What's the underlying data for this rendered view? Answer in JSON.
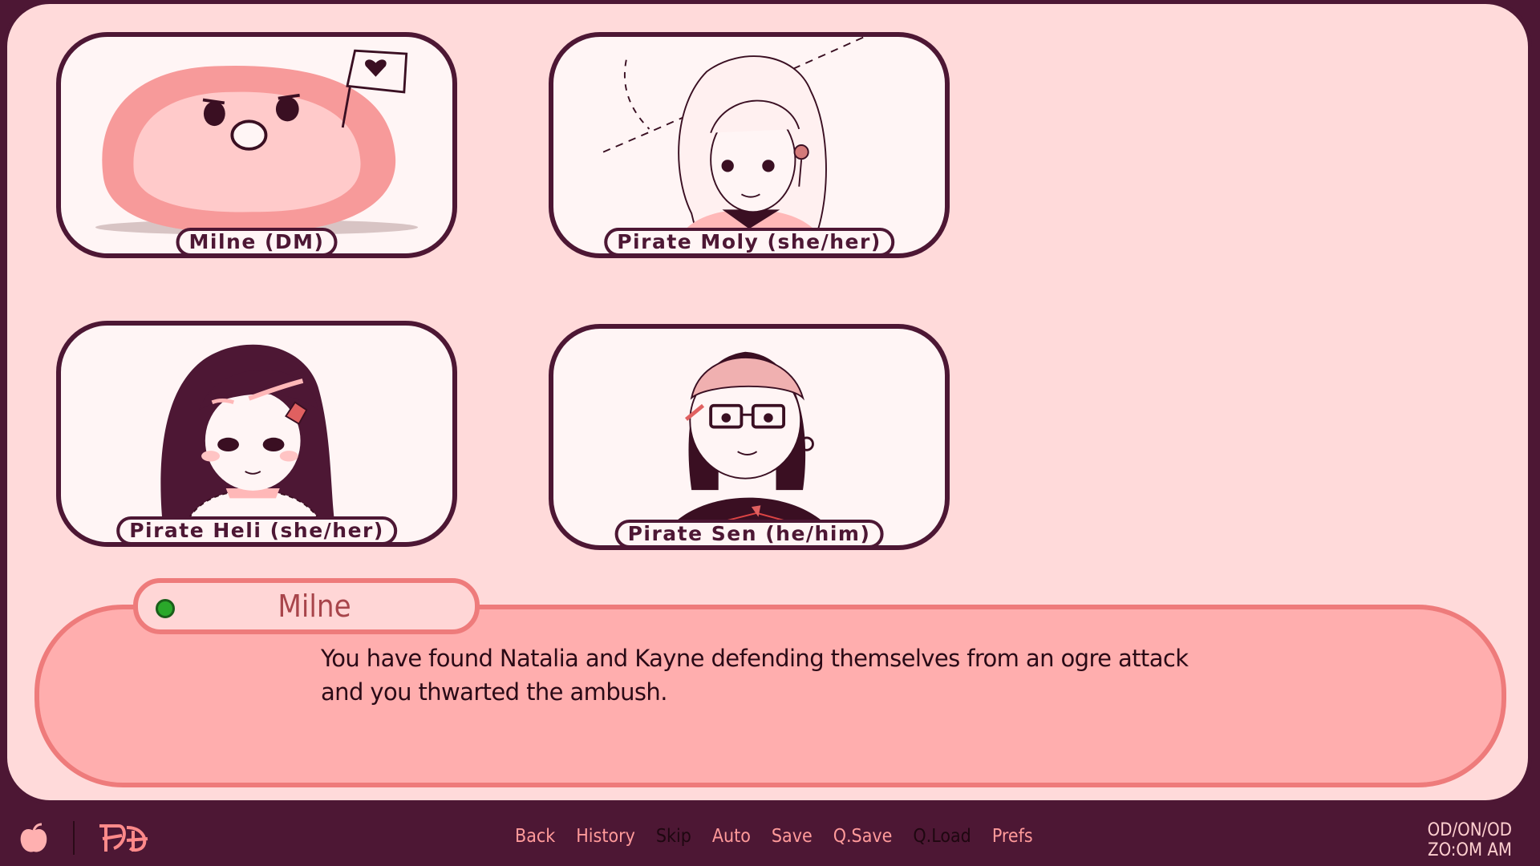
{
  "characters": [
    {
      "name": "Milne (DM)"
    },
    {
      "name": "Pirate Moly (she/her)"
    },
    {
      "name": "Pirate Heli (she/her)"
    },
    {
      "name": "Pirate Sen (he/him)"
    }
  ],
  "dialogue": {
    "speaker": "Milne",
    "text": "You have found Natalia and Kayne defending themselves from an ogre attack and you thwarted the ambush."
  },
  "toolbar": {
    "menu": {
      "back": "Back",
      "history": "History",
      "skip": "Skip",
      "auto": "Auto",
      "save": "Save",
      "qsave": "Q.Save",
      "qload": "Q.Load",
      "prefs": "Prefs"
    },
    "date": "OD/ON/OD",
    "time": "ZO:OM AM"
  },
  "colors": {
    "background": "#ffdada",
    "frame": "#4d1734",
    "dialogue_box": "#ffaeae",
    "dialogue_border": "#ee7b7b",
    "menu_text": "#ff9a9a",
    "status_dot": "#2aa82a"
  },
  "icons": [
    "peach-icon",
    "game-logo-icon",
    "speaker-status-icon"
  ]
}
